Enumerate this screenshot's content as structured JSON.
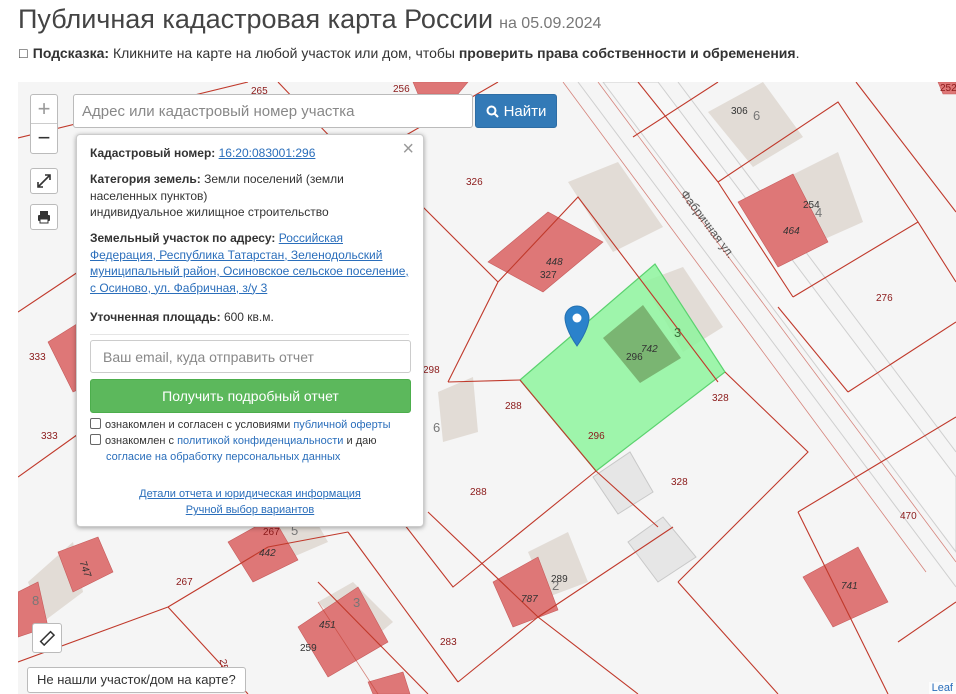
{
  "header": {
    "title": "Публичная кадастровая карта России",
    "date": "на 05.09.2024"
  },
  "hint": {
    "label": "Подсказка:",
    "text": " Кликните на карте на любой участок или дом, чтобы ",
    "bold": "проверить права собственности и обременения",
    "end": "."
  },
  "search": {
    "placeholder": "Адрес или кадастровый номер участка",
    "button_label": "Найти"
  },
  "zoom": {
    "in": "+",
    "out": "−"
  },
  "popup": {
    "cadastral_label": "Кадастровый номер:",
    "cadastral_value": "16:20:083001:296",
    "category_label": "Категория земель:",
    "category_line1": "Земли поселений (земли",
    "category_line2": "населенных пунктов)",
    "category_line3": "индивидуальное жилищное строительство",
    "address_label": "Земельный участок по адресу:",
    "address_line1": "Российская",
    "address_line2": "Федерация, Республика Татарстан, Зеленодольский",
    "address_line3": "муниципальный район, Осиновское сельское поселение,",
    "address_line4": "с Осиново, ул. Фабричная, з/у 3",
    "area_label": "Уточненная площадь:",
    "area_value": "600 кв.м.",
    "email_placeholder": "Ваш email, куда отправить отчет",
    "report_button": "Получить подробный отчет",
    "check1_text": "ознакомлен и согласен с условиями ",
    "check1_link": "публичной оферты",
    "check2_text": "ознакомлен с ",
    "check2_link": "политикой конфиденциальности",
    "check2_text2": " и даю",
    "check2_link2": "согласие на обработку персональных данных",
    "details_link": "Детали отчета и юридическая информация",
    "manual_link": "Ручной выбор вариантов"
  },
  "map": {
    "street_label": "Фабричная ул.",
    "labels": [
      {
        "text": "265"
      },
      {
        "text": "256"
      },
      {
        "text": "252"
      },
      {
        "text": "306"
      },
      {
        "text": "6"
      },
      {
        "text": "326"
      },
      {
        "text": "254"
      },
      {
        "text": "4"
      },
      {
        "text": "464"
      },
      {
        "text": "448"
      },
      {
        "text": "327"
      },
      {
        "text": "276"
      },
      {
        "text": "333"
      },
      {
        "text": "298"
      },
      {
        "text": "296"
      },
      {
        "text": "742"
      },
      {
        "text": "3"
      },
      {
        "text": "328"
      },
      {
        "text": "288"
      },
      {
        "text": "6"
      },
      {
        "text": "333"
      },
      {
        "text": "296"
      },
      {
        "text": "288"
      },
      {
        "text": "328"
      },
      {
        "text": "470"
      },
      {
        "text": "267"
      },
      {
        "text": "5"
      },
      {
        "text": "442"
      },
      {
        "text": "747"
      },
      {
        "text": "289"
      },
      {
        "text": "2"
      },
      {
        "text": "787"
      },
      {
        "text": "741"
      },
      {
        "text": "267"
      },
      {
        "text": "8"
      },
      {
        "text": "3"
      },
      {
        "text": "451"
      },
      {
        "text": "259"
      },
      {
        "text": "283"
      },
      {
        "text": "25"
      }
    ]
  },
  "bottom": {
    "not_found": "Не нашли участок/дом на карте?",
    "attribution": "Leaf"
  },
  "colors": {
    "parcel_line": "#c0392b",
    "building": "#de7777",
    "selected_parcel": "#8ef59e",
    "search_button": "#337ab7",
    "report_button": "#5cb85c",
    "marker": "#2b82cb"
  }
}
